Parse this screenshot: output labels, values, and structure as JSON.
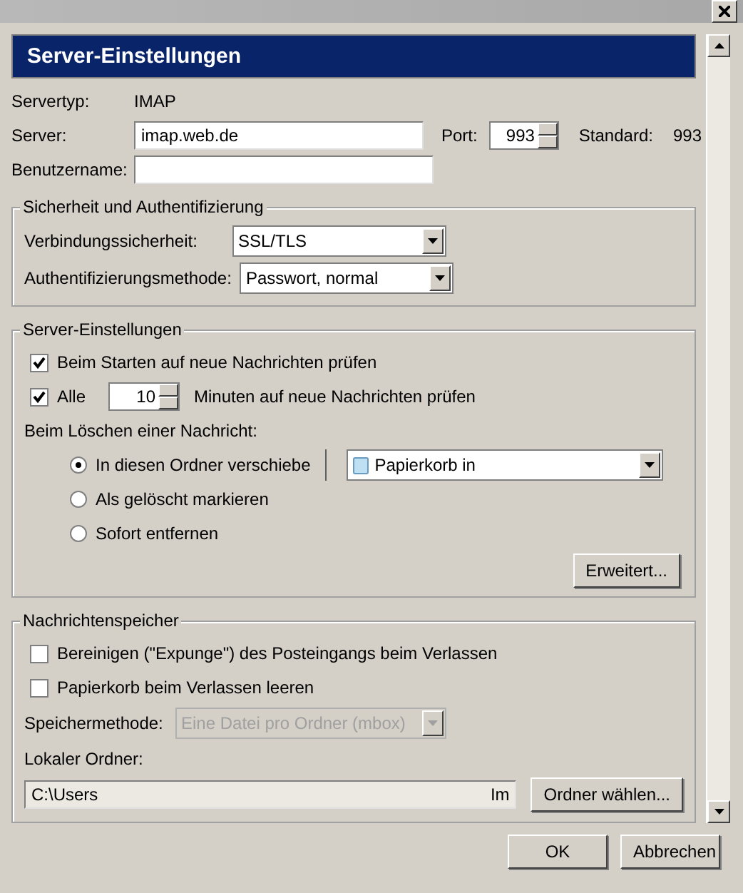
{
  "header": {
    "title": "Server-Einstellungen"
  },
  "server_type": {
    "label": "Servertyp:",
    "value": "IMAP"
  },
  "server": {
    "label": "Server:",
    "value": "imap.web.de"
  },
  "port": {
    "label": "Port:",
    "value": "993"
  },
  "default_port": {
    "label": "Standard:",
    "value": "993"
  },
  "username": {
    "label": "Benutzername:"
  },
  "security": {
    "title": "Sicherheit und Authentifizierung",
    "fields": [
      {
        "label": "Verbindungssicherheit:",
        "value": "SSL/TLS"
      },
      {
        "label": "Authentifizierungsmethode:",
        "value": "Passwort, normal"
      }
    ]
  },
  "server_settings": {
    "title": "Server-Einstellungen",
    "check_on_start": {
      "label": "Beim Starten auf neue Nachrichten prüfen",
      "checked": true
    },
    "check_every": {
      "label": "Alle",
      "checked": true,
      "minutes": "10",
      "suffix": "Minuten auf neue Nachrichten prüfen"
    },
    "delete_label": "Beim Löschen einer Nachricht:",
    "delete_options": [
      {
        "label": "In diesen Ordner verschiebe",
        "selected": true
      },
      {
        "label": "Als gelöscht markieren",
        "selected": false
      },
      {
        "label": "Sofort entfernen",
        "selected": false
      }
    ],
    "folder": {
      "value": "Papierkorb in"
    },
    "advanced_button": "Erweitert..."
  },
  "storage": {
    "title": "Nachrichtenspeicher",
    "checkboxes": [
      {
        "label": "Bereinigen (\"Expunge\") des Posteingangs beim Verlassen",
        "checked": false
      },
      {
        "label": "Papierkorb beim Verlassen leeren",
        "checked": false
      }
    ],
    "method": {
      "label": "Speichermethode:",
      "value": "Eine Datei pro Ordner (mbox)",
      "disabled": true
    },
    "local_folder": {
      "label": "Lokaler Ordner:",
      "value": "C:\\Users",
      "value_end": "Im"
    },
    "choose_button": "Ordner wählen..."
  },
  "buttons": [
    {
      "label": "OK"
    },
    {
      "label": "Abbrechen"
    }
  ]
}
